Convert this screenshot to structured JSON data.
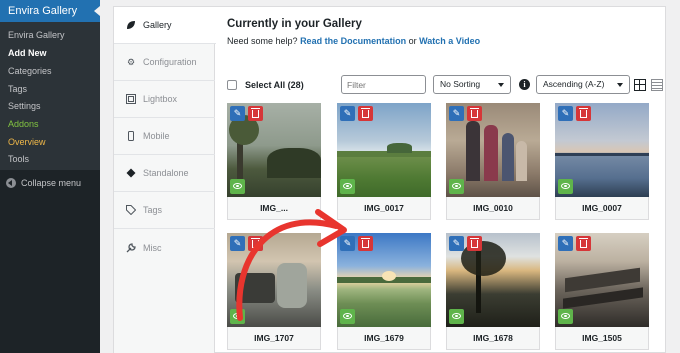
{
  "wp_menu": {
    "title": "Envira Gallery",
    "items": [
      {
        "label": "Envira Gallery",
        "style": "normal"
      },
      {
        "label": "Add New",
        "style": "current"
      },
      {
        "label": "Categories",
        "style": "normal"
      },
      {
        "label": "Tags",
        "style": "normal"
      },
      {
        "label": "Settings",
        "style": "normal"
      },
      {
        "label": "Addons",
        "style": "green"
      },
      {
        "label": "Overview",
        "style": "orange"
      },
      {
        "label": "Tools",
        "style": "normal"
      }
    ],
    "collapse_label": "Collapse menu",
    "colors": {
      "sidebar": "#1d2327",
      "active": "#2271b1",
      "addons": "#82c341",
      "overview": "#f0b849"
    }
  },
  "tabs": [
    {
      "label": "Gallery",
      "icon": "leaf-icon",
      "active": true
    },
    {
      "label": "Configuration",
      "icon": "gear-icon",
      "active": false
    },
    {
      "label": "Lightbox",
      "icon": "lightbox-icon",
      "active": false
    },
    {
      "label": "Mobile",
      "icon": "mobile-icon",
      "active": false
    },
    {
      "label": "Standalone",
      "icon": "standalone-icon",
      "active": false
    },
    {
      "label": "Tags",
      "icon": "tag-icon",
      "active": false
    },
    {
      "label": "Misc",
      "icon": "wrench-icon",
      "active": false
    }
  ],
  "header": {
    "title": "Currently in your Gallery",
    "help_prefix": "Need some help?",
    "doc_link": "Read the Documentation",
    "help_or": "or",
    "video_link": "Watch a Video"
  },
  "toolbar": {
    "select_all": "Select All (28)",
    "filter_placeholder": "Filter",
    "sort_value": "No Sorting",
    "order_value": "Ascending (A-Z)"
  },
  "images": [
    {
      "caption": "IMG_...",
      "scene": "p1"
    },
    {
      "caption": "IMG_0017",
      "scene": "p2"
    },
    {
      "caption": "IMG_0010",
      "scene": "p3"
    },
    {
      "caption": "IMG_0007",
      "scene": "p4"
    },
    {
      "caption": "IMG_1707",
      "scene": "p5"
    },
    {
      "caption": "IMG_1679",
      "scene": "p6"
    },
    {
      "caption": "IMG_1678",
      "scene": "p7"
    },
    {
      "caption": "IMG_1505",
      "scene": "p8"
    }
  ],
  "colors": {
    "edit": "#2f6fb8",
    "delete": "#d63638",
    "view": "#5fb44b",
    "arrow": "#e8352e",
    "link": "#2271b1"
  }
}
